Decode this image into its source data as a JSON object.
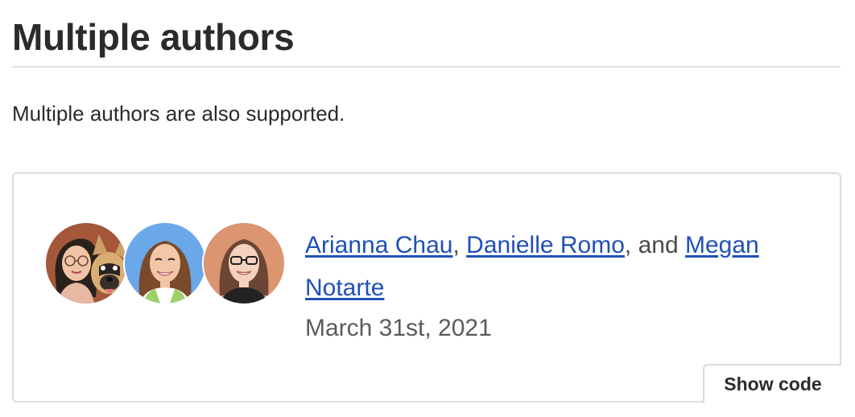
{
  "section": {
    "title": "Multiple authors",
    "description": "Multiple authors are also supported."
  },
  "example": {
    "authors": [
      {
        "name": "Arianna Chau",
        "avatar_icon": "person-with-dog-avatar"
      },
      {
        "name": "Danielle Romo",
        "avatar_icon": "person-avatar"
      },
      {
        "name": "Megan Notarte",
        "avatar_icon": "person-with-glasses-avatar"
      }
    ],
    "separator_comma": ",",
    "conjunction": ", and",
    "date": "March 31st, 2021",
    "show_code_label": "Show code"
  },
  "colors": {
    "link": "#1f50b5",
    "heading": "#2b2b2b",
    "muted_text": "#5b5b5b",
    "border": "#dcdcdc",
    "avatar_bg_1": "#a5573a",
    "avatar_bg_2": "#6aa8ea",
    "avatar_bg_3": "#db9571"
  }
}
